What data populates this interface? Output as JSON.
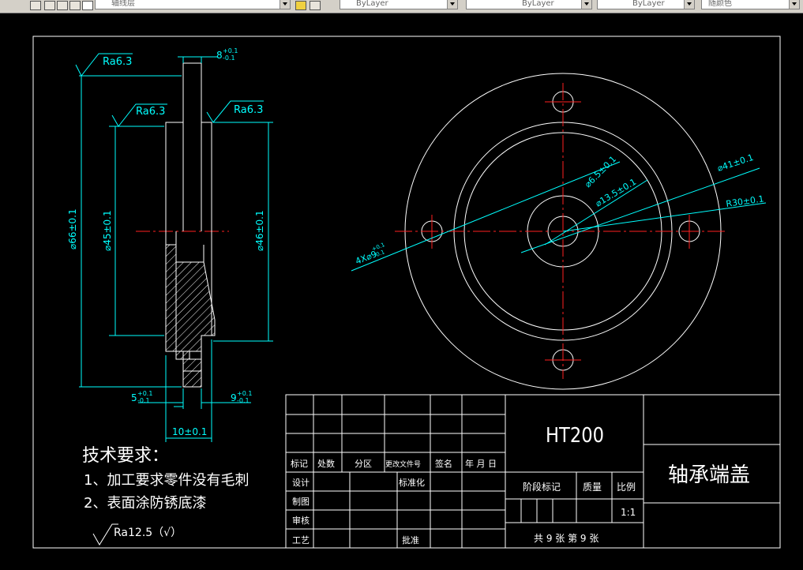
{
  "toolbar": {
    "layer_combo": "轴线层",
    "color_combo": "ByLayer",
    "linetype_combo": "ByLayer",
    "lineweight_combo": "ByLayer",
    "plotstyle_combo": "随颜色"
  },
  "dimensions": {
    "ra_top": "Ra6.3",
    "ra_mid_left": "Ra6.3",
    "ra_mid_right": "Ra6.3",
    "thickness_8": "8",
    "thickness_8_tol_upper": "+0.1",
    "thickness_8_tol_lower": "-0.1",
    "dia_66": "⌀66±0.1",
    "dia_45": "⌀45±0.1",
    "dia_46": "⌀46±0.1",
    "width_5": "5",
    "width_5_tol_upper": "+0.1",
    "width_5_tol_lower": "-0.1",
    "width_9": "9",
    "width_9_tol_upper": "+0.1",
    "width_9_tol_lower": "-0.1",
    "width_10": "10±0.1",
    "dia_6_5": "⌀6.5±0.1",
    "dia_13_5": "⌀13.5±0.1",
    "dia_41": "⌀41±0.1",
    "radius_30": "R30±0.1",
    "holes": "4X⌀9",
    "holes_tol_upper": "+0.1",
    "holes_tol_lower": "-0.1"
  },
  "tech_requirements": {
    "title": "技术要求：",
    "item1": "1、加工要求零件没有毛刺",
    "item2": "2、表面涂防锈底漆",
    "roughness": "Ra12.5（√）"
  },
  "title_block": {
    "material": "HT200",
    "part_name": "轴承端盖",
    "col_mark": "标记",
    "col_count": "处数",
    "col_zone": "分区",
    "col_change_doc": "更改文件号",
    "col_sign": "签名",
    "col_date": "年 月 日",
    "row_design": "设计",
    "row_standard": "标准化",
    "row_draw": "制图",
    "row_review": "审核",
    "row_process": "工艺",
    "row_approve": "批准",
    "stage_mark": "阶段标记",
    "mass": "质量",
    "scale": "比例",
    "scale_value": "1:1",
    "sheet_info": "共 9 张  第 9 张"
  }
}
